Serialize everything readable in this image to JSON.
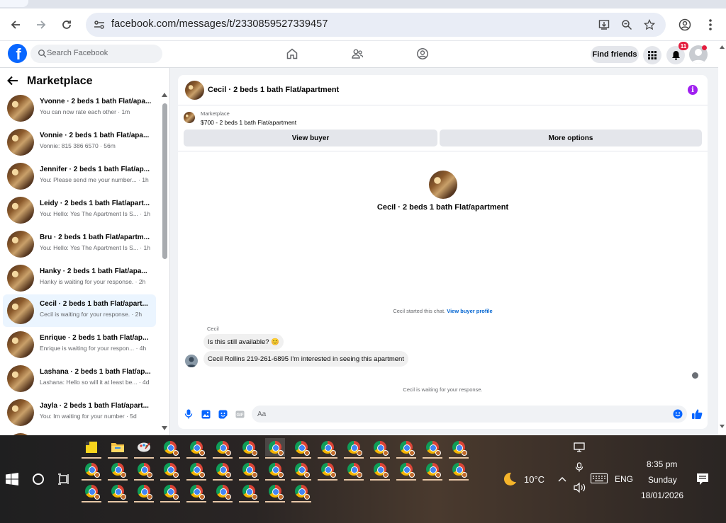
{
  "browser": {
    "url": "facebook.com/messages/t/2330859527339457"
  },
  "facebook": {
    "logo_letter": "f",
    "search_placeholder": "Search Facebook",
    "find_friends": "Find friends",
    "notification_count": "11"
  },
  "sidebar": {
    "title": "Marketplace",
    "conversations": [
      {
        "name": "Yvonne · 2 beds 1 bath Flat/apa...",
        "snippet": "You can now rate each other · 1m"
      },
      {
        "name": "Vonnie · 2 beds 1 bath Flat/apa...",
        "snippet": "Vonnie: 815 386 6570 · 56m"
      },
      {
        "name": "Jennifer · 2 beds 1 bath Flat/ap...",
        "snippet": "You: Please send me your number... · 1h"
      },
      {
        "name": "Leidy · 2 beds 1 bath Flat/apart...",
        "snippet": "You: Hello: Yes The Apartment Is S... · 1h"
      },
      {
        "name": "Bru · 2 beds 1 bath Flat/apartm...",
        "snippet": "You: Hello: Yes The Apartment Is S... · 1h"
      },
      {
        "name": "Hanky · 2 beds 1 bath Flat/apa...",
        "snippet": "Hanky is waiting for your response. · 2h"
      },
      {
        "name": "Cecil · 2 beds 1 bath Flat/apart...",
        "snippet": "Cecil is waiting for your response. · 2h"
      },
      {
        "name": "Enrique · 2 beds 1 bath Flat/ap...",
        "snippet": "Enrique is waiting for your respon... · 4h"
      },
      {
        "name": "Lashana · 2 beds 1 bath Flat/ap...",
        "snippet": "Lashana: Hello so will it at least be... · 4d"
      },
      {
        "name": "Jayla · 2 beds 1 bath Flat/apart...",
        "snippet": "You: Im waiting for your number · 5d"
      }
    ]
  },
  "chat": {
    "title": "Cecil · 2 beds 1 bath Flat/apartment",
    "listing_source": "Marketplace",
    "listing_title": "$700 - 2 beds 1 bath Flat/apartment",
    "view_buyer": "View buyer",
    "more_options": "More options",
    "center_name": "Cecil · 2 beds 1 bath Flat/apartment",
    "started_note": "Cecil started this chat.",
    "view_buyer_profile": "View buyer profile",
    "sender_label": "Cecil",
    "messages": [
      "Is this still available? 😊",
      "Cecil Rollins 219-261-6895 I'm interested in seeing this apartment"
    ],
    "waiting_note": "Cecil is waiting for your response.",
    "input_placeholder": "Aa"
  },
  "taskbar": {
    "weather_temp": "10°C",
    "language": "ENG",
    "time": "8:35 pm",
    "day": "Sunday",
    "date": "18/01/2026"
  }
}
